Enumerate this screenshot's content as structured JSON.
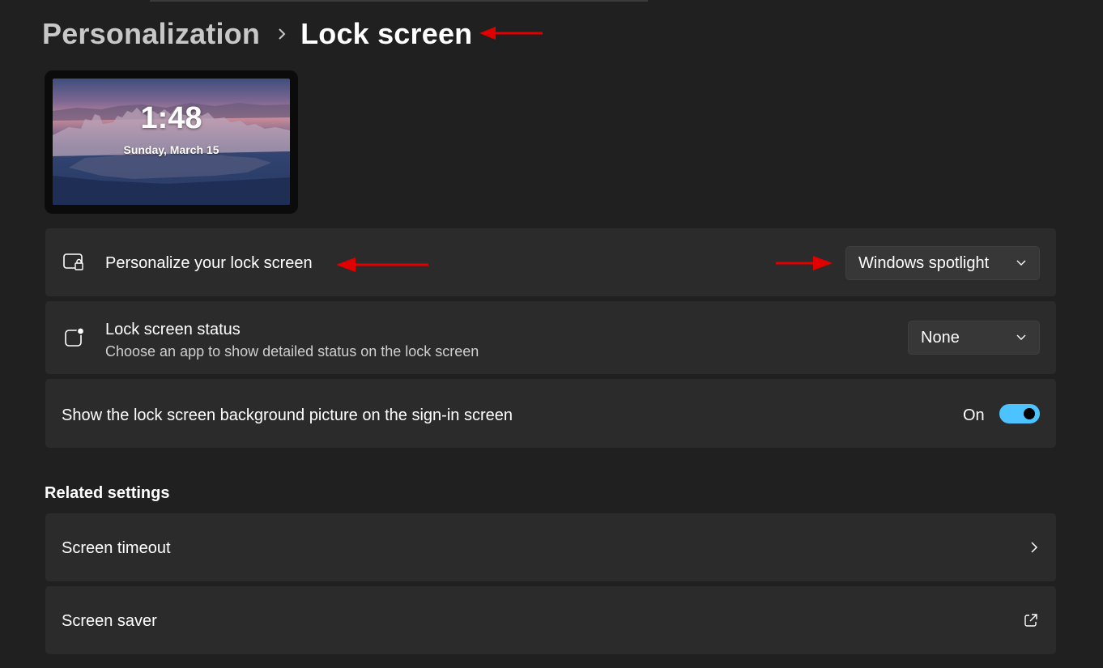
{
  "header": {
    "parent": "Personalization",
    "current": "Lock screen"
  },
  "preview": {
    "time": "1:48",
    "date": "Sunday, March 15"
  },
  "personalize": {
    "title": "Personalize your lock screen",
    "value": "Windows spotlight"
  },
  "status": {
    "title": "Lock screen status",
    "subtitle": "Choose an app to show detailed status on the lock screen",
    "value": "None"
  },
  "signin_background": {
    "title": "Show the lock screen background picture on the sign-in screen",
    "toggle_label": "On",
    "toggle_on": true
  },
  "related": {
    "heading": "Related settings",
    "items": [
      {
        "label": "Screen timeout",
        "icon": "chevron-right-icon"
      },
      {
        "label": "Screen saver",
        "icon": "external-link-icon"
      }
    ]
  },
  "colors": {
    "background": "#202020",
    "card": "#2b2b2b",
    "accent": "#4cc2ff",
    "annotation_arrow": "#e00000"
  }
}
